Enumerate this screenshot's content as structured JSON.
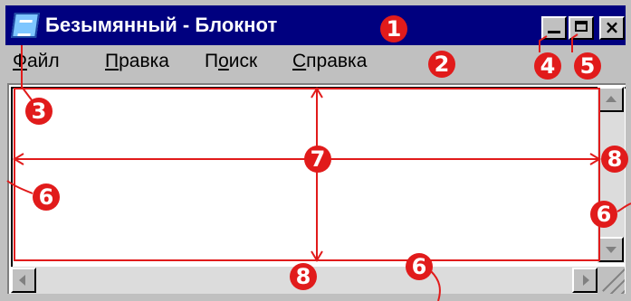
{
  "window": {
    "title": "Безымянный - Блокнот",
    "icon": "notepad-icon",
    "controls": {
      "minimize": "minimize-icon",
      "maximize": "maximize-icon",
      "close_label": "×"
    }
  },
  "menu": {
    "items": [
      {
        "label": "Файл",
        "accel": "Ф"
      },
      {
        "label": "Правка",
        "accel": "П"
      },
      {
        "label": "Поиск",
        "accel": "о"
      },
      {
        "label": "Справка",
        "accel": "С"
      }
    ]
  },
  "annotations": {
    "color": "#e11b1b",
    "callouts": [
      "1",
      "2",
      "3",
      "4",
      "5",
      "6",
      "6",
      "6",
      "7",
      "8",
      "8"
    ]
  },
  "colors": {
    "title_bar": "#00007f",
    "chrome": "#c0c0c0",
    "annotation": "#e11b1b"
  }
}
